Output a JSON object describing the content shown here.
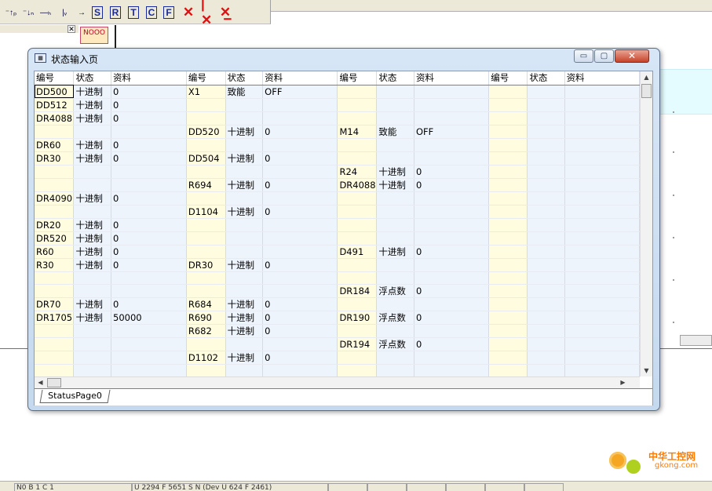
{
  "toolbar": {
    "items": [
      {
        "name": "rising-contact-icon",
        "glyph": "⁻↑ₚ"
      },
      {
        "name": "falling-contact-icon",
        "glyph": "⁻↓ₙ"
      },
      {
        "name": "horizontal-line-icon",
        "glyph": "—ₕ"
      },
      {
        "name": "vertical-line-icon",
        "glyph": "|ᵥ"
      },
      {
        "name": "arrow-right-icon",
        "glyph": "→"
      },
      {
        "name": "set-coil-icon",
        "glyph": "S"
      },
      {
        "name": "reset-coil-icon",
        "glyph": "R"
      },
      {
        "name": "timer-icon",
        "glyph": "T"
      },
      {
        "name": "counter-icon",
        "glyph": "C"
      },
      {
        "name": "function-icon",
        "glyph": "F"
      },
      {
        "name": "delete-icon",
        "glyph": "✕"
      },
      {
        "name": "delete-vertical-icon",
        "glyph": "|✕"
      },
      {
        "name": "delete-horizontal-icon",
        "glyph": "✕̲"
      }
    ]
  },
  "ladder": {
    "noo_label": "NOOO"
  },
  "window": {
    "title": "状态输入页",
    "buttons": {
      "minimize": "▭",
      "maximize": "▢",
      "close": "✕"
    },
    "headers": [
      "编号",
      "状态",
      "资料",
      "编号",
      "状态",
      "资料",
      "编号",
      "状态",
      "资料",
      "编号",
      "状态",
      "资料"
    ],
    "rows": [
      [
        "DD500",
        "十进制",
        "0",
        "X1",
        "致能",
        "OFF",
        "",
        "",
        "",
        "",
        "",
        ""
      ],
      [
        "DD512",
        "十进制",
        "0",
        "",
        "",
        "",
        "",
        "",
        "",
        "",
        "",
        ""
      ],
      [
        "DR4088",
        "十进制",
        "0",
        "",
        "",
        "",
        "",
        "",
        "",
        "",
        "",
        ""
      ],
      [
        "",
        "",
        "",
        "DD520",
        "十进制",
        "0",
        "M14",
        "致能",
        "OFF",
        "",
        "",
        ""
      ],
      [
        "DR60",
        "十进制",
        "0",
        "",
        "",
        "",
        "",
        "",
        "",
        "",
        "",
        ""
      ],
      [
        "DR30",
        "十进制",
        "0",
        "DD504",
        "十进制",
        "0",
        "",
        "",
        "",
        "",
        "",
        ""
      ],
      [
        "",
        "",
        "",
        "",
        "",
        "",
        "R24",
        "十进制",
        "0",
        "",
        "",
        ""
      ],
      [
        "",
        "",
        "",
        "R694",
        "十进制",
        "0",
        "DR4088",
        "十进制",
        "0",
        "",
        "",
        ""
      ],
      [
        "DR4090",
        "十进制",
        "0",
        "",
        "",
        "",
        "",
        "",
        "",
        "",
        "",
        ""
      ],
      [
        "",
        "",
        "",
        "D1104",
        "十进制",
        "0",
        "",
        "",
        "",
        "",
        "",
        ""
      ],
      [
        "DR20",
        "十进制",
        "0",
        "",
        "",
        "",
        "",
        "",
        "",
        "",
        "",
        ""
      ],
      [
        "DR520",
        "十进制",
        "0",
        "",
        "",
        "",
        "",
        "",
        "",
        "",
        "",
        ""
      ],
      [
        "R60",
        "十进制",
        "0",
        "",
        "",
        "",
        "D491",
        "十进制",
        "0",
        "",
        "",
        ""
      ],
      [
        "R30",
        "十进制",
        "0",
        "DR30",
        "十进制",
        "0",
        "",
        "",
        "",
        "",
        "",
        ""
      ],
      [
        "",
        "",
        "",
        "",
        "",
        "",
        "",
        "",
        "",
        "",
        "",
        ""
      ],
      [
        "",
        "",
        "",
        "",
        "",
        "",
        "DR184",
        "浮点数",
        "0",
        "",
        "",
        ""
      ],
      [
        "DR70",
        "十进制",
        "0",
        "R684",
        "十进制",
        "0",
        "",
        "",
        "",
        "",
        "",
        ""
      ],
      [
        "DR1705",
        "十进制",
        "50000",
        "R690",
        "十进制",
        "0",
        "DR190",
        "浮点数",
        "0",
        "",
        "",
        ""
      ],
      [
        "",
        "",
        "",
        "R682",
        "十进制",
        "0",
        "",
        "",
        "",
        "",
        "",
        ""
      ],
      [
        "",
        "",
        "",
        "",
        "",
        "",
        "DR194",
        "浮点数",
        "0",
        "",
        "",
        ""
      ],
      [
        "",
        "",
        "",
        "D1102",
        "十进制",
        "0",
        "",
        "",
        "",
        "",
        "",
        ""
      ],
      [
        "",
        "",
        "",
        "",
        "",
        "",
        "",
        "",
        "",
        "",
        "",
        ""
      ]
    ],
    "tab_label": "StatusPage0"
  },
  "statusbar": {
    "cells": [
      "N0 B 1 C 1",
      "U 2294 F 5651 S N (Dev U 624 F 2461)",
      "",
      "",
      "",
      "",
      "",
      ""
    ]
  },
  "watermark": {
    "cn": "中华工控网",
    "en": "gkong.com"
  }
}
